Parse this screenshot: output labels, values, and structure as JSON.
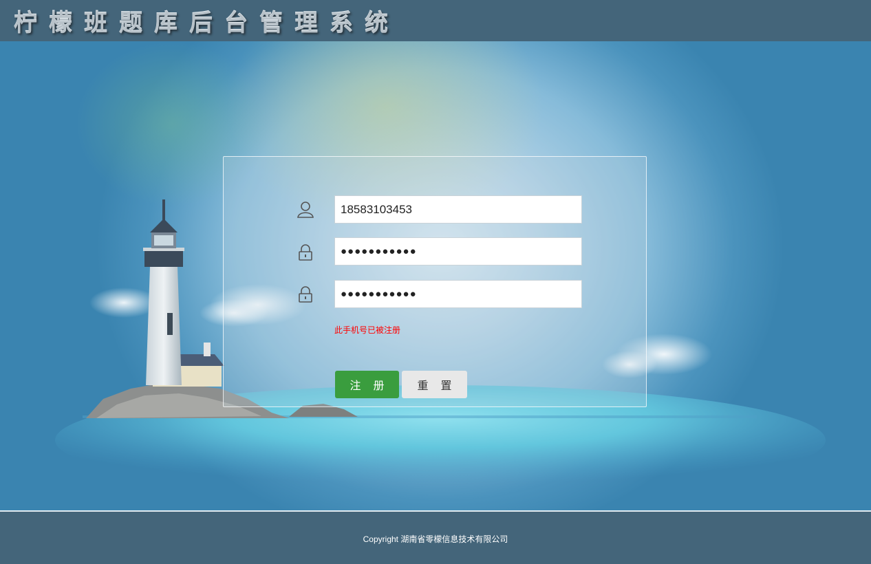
{
  "header": {
    "title": "柠檬班题库后台管理系统"
  },
  "form": {
    "phone": {
      "icon": "user-icon",
      "value": "18583103453"
    },
    "password": {
      "icon": "lock-icon",
      "value": "●●●●●●●●●●●"
    },
    "confirm_password": {
      "icon": "lock-icon",
      "value": "●●●●●●●●●●●"
    },
    "error_message": "此手机号已被注册",
    "register_label": "注册",
    "reset_label": "重置"
  },
  "footer": {
    "copyright": "Copyright 湖南省零檬信息技术有限公司"
  },
  "colors": {
    "header_bg": "#44657a",
    "register_button": "#3a9d3e",
    "reset_button": "#e8e8e8",
    "error_text": "#ff0000"
  }
}
